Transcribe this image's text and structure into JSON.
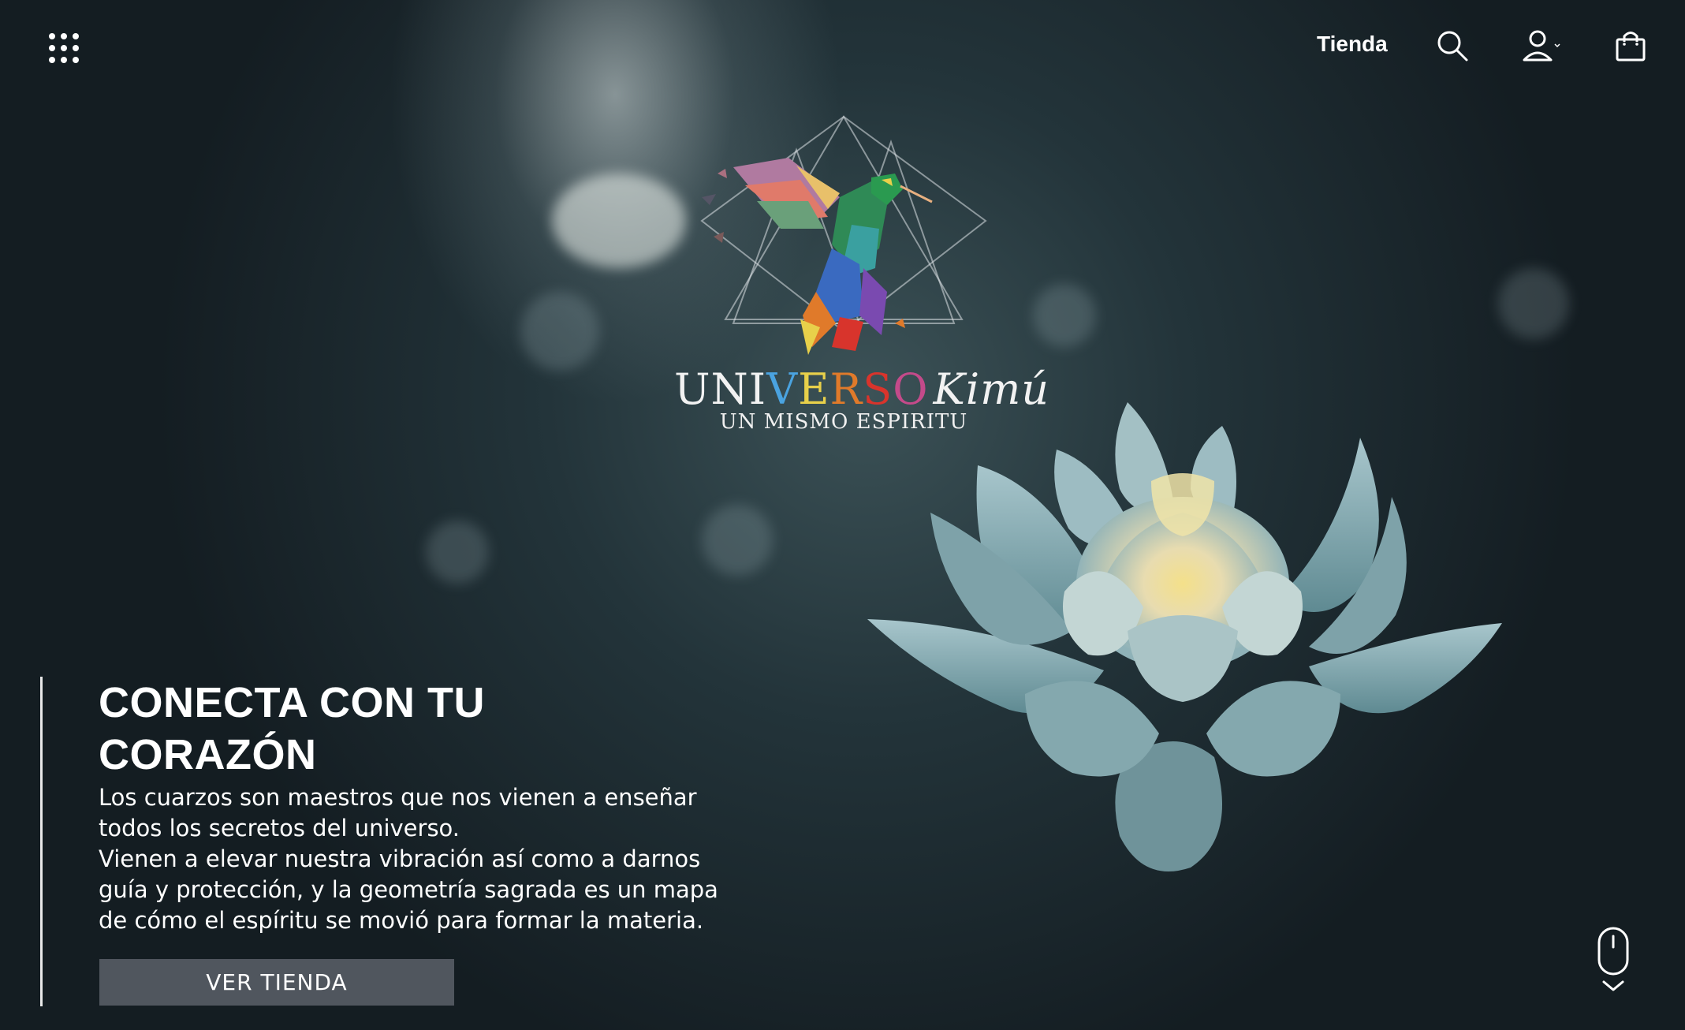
{
  "header": {
    "nav_link": "Tienda",
    "icons": [
      "apps-grid-icon",
      "search-icon",
      "user-icon",
      "shopping-bag-icon"
    ]
  },
  "logo": {
    "word_letters": [
      "U",
      "N",
      "I",
      "V",
      "E",
      "R",
      "S",
      "O"
    ],
    "letter_colors": [
      "#f2f2f2",
      "#f2f2f2",
      "#f2f2f2",
      "#4aa3e0",
      "#e8d04a",
      "#e07a2a",
      "#d8342c",
      "#c44a8a"
    ],
    "brand_suffix": "Kimú",
    "tagline": "UN MISMO ESPIRITU"
  },
  "hero": {
    "title_line1": "CONECTA CON TU",
    "title_line2": "CORAZÓN",
    "body_paragraph1": "Los cuarzos son maestros que nos vienen a enseñar todos los secretos del universo.",
    "body_paragraph2": "Vienen a elevar nuestra vibración así como a darnos guía y protección, y la geometría sagrada es un mapa de cómo el espíritu se movió para formar la materia.",
    "cta_label": "VER TIENDA"
  },
  "colors": {
    "accent_text": "#ffffff",
    "button_bg": "#5a6068",
    "background_dark": "#1a2429"
  }
}
